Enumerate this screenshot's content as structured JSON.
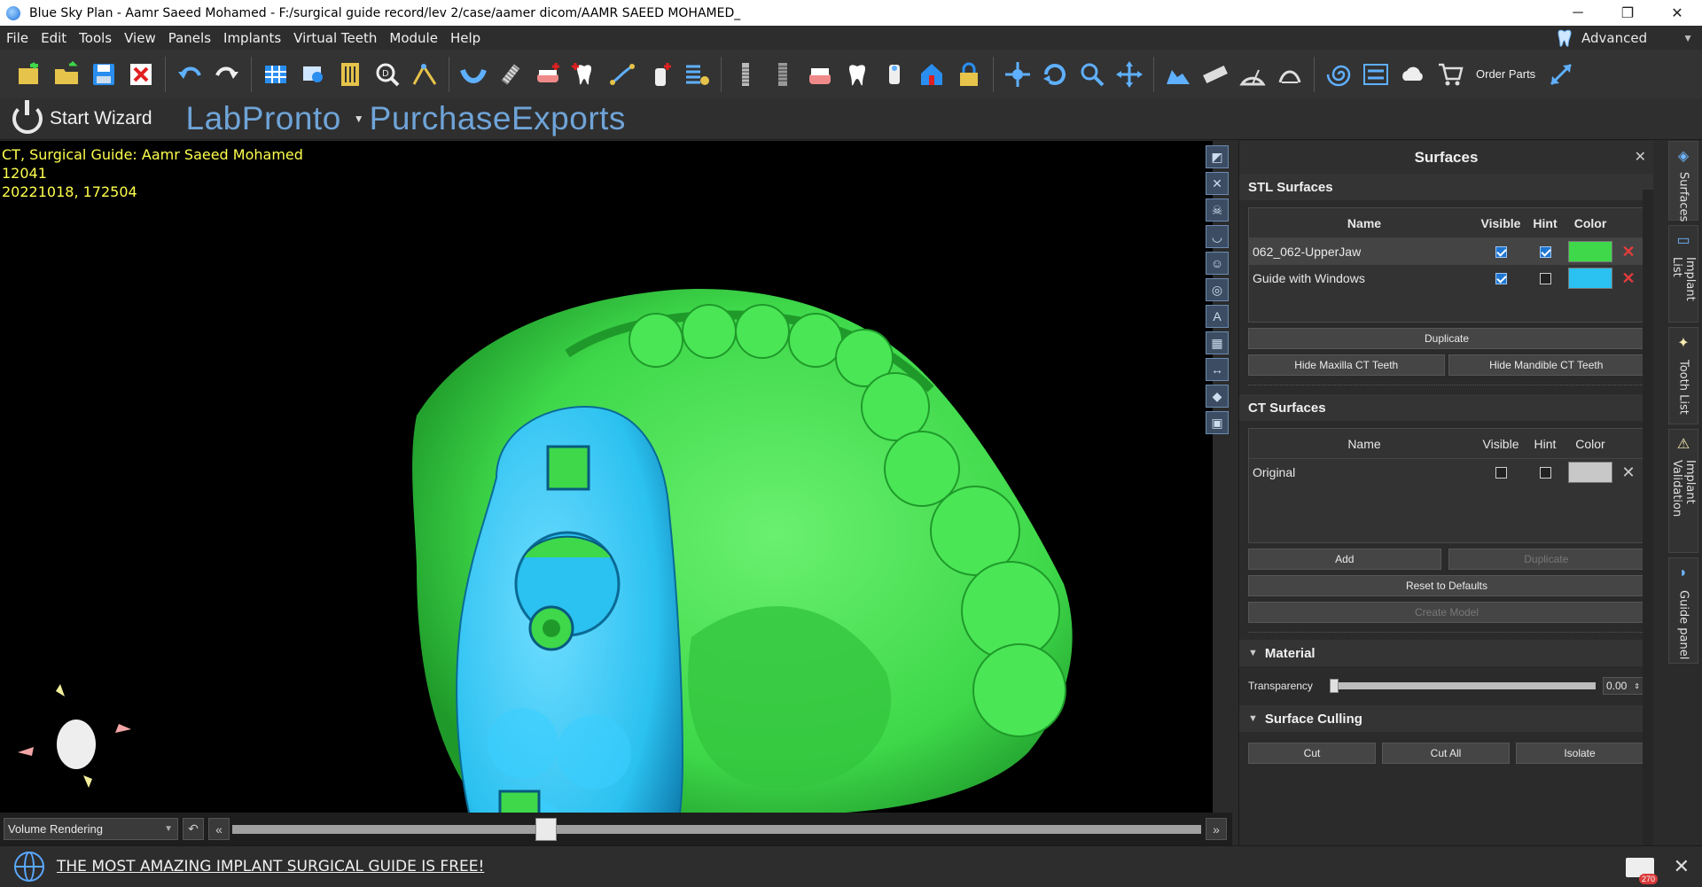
{
  "window": {
    "title": "Blue Sky Plan - Aamr Saeed Mohamed - F:/surgical guide record/lev 2/case/aamer dicom/AAMR SAEED MOHAMED_",
    "minimize": "─",
    "maximize": "❐",
    "close": "✕"
  },
  "menu": {
    "items": [
      "File",
      "Edit",
      "Tools",
      "View",
      "Panels",
      "Implants",
      "Virtual Teeth",
      "Module",
      "Help"
    ],
    "mode_label": "Advanced"
  },
  "toolbar": {
    "order_parts": "Order Parts"
  },
  "wizard": {
    "start_label": "Start Wizard",
    "labpronto": "LabPronto",
    "purchase": "PurchaseExports"
  },
  "viewport": {
    "info_line1": "CT, Surgical Guide: Aamr Saeed Mohamed",
    "info_line2": "12041",
    "info_line3": "20221018, 172504",
    "render_mode": "Volume Rendering",
    "slider_value": 0.32
  },
  "status": {
    "promo": "THE MOST AMAZING IMPLANT SURGICAL GUIDE IS FREE!",
    "mail_count": "270"
  },
  "panel": {
    "title": "Surfaces",
    "stl": {
      "heading": "STL Surfaces",
      "columns": [
        "Name",
        "Visible",
        "Hint",
        "Color"
      ],
      "rows": [
        {
          "name": "062_062-UpperJaw",
          "visible": true,
          "hint": true,
          "color": "#3ed84a"
        },
        {
          "name": "Guide with Windows",
          "visible": true,
          "hint": false,
          "color": "#2bc1f0"
        }
      ],
      "duplicate": "Duplicate",
      "hide_maxilla": "Hide Maxilla CT Teeth",
      "hide_mandible": "Hide Mandible CT Teeth"
    },
    "ct": {
      "heading": "CT Surfaces",
      "columns": [
        "Name",
        "Visible",
        "Hint",
        "Color"
      ],
      "rows": [
        {
          "name": "Original",
          "visible": false,
          "hint": false,
          "color": "#c8c8c8"
        }
      ],
      "add": "Add",
      "duplicate": "Duplicate",
      "reset": "Reset to Defaults",
      "create_model": "Create Model"
    },
    "material": {
      "heading": "Material",
      "transparency_label": "Transparency",
      "transparency_value": "0.00"
    },
    "culling": {
      "heading": "Surface Culling",
      "cut": "Cut",
      "cut_all": "Cut All",
      "isolate": "Isolate"
    }
  },
  "side_tabs": [
    "Surfaces",
    "Implant List",
    "Tooth List",
    "Implant Validation",
    "Guide panel"
  ],
  "colors": {
    "jaw_green": "#3ed84a",
    "guide_blue": "#2bc1f0",
    "info_yellow": "#ffff4d",
    "accent": "#52b9ff"
  }
}
